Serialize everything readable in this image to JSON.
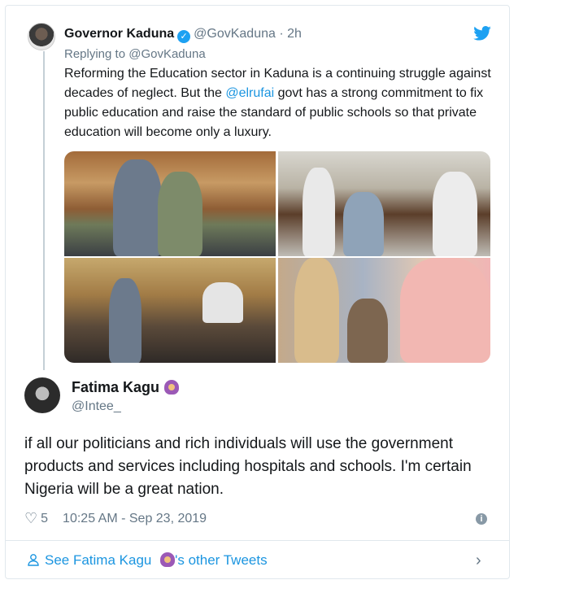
{
  "quoted_tweet": {
    "name": "Governor Kaduna",
    "handle": "@GovKaduna",
    "time": "2h",
    "replying_to": "Replying to @GovKaduna",
    "text_before": "Reforming the Education sector in Kaduna is a continuing struggle against decades of neglect. But the ",
    "mention": "@elrufai",
    "text_after": " govt has a strong commitment to fix public education and raise the standard of public schools so that private education will become only a luxury.",
    "photo_count": 4
  },
  "tweet": {
    "name": "Fatima Kagu",
    "handle": "@Intee_",
    "text": "if all our politicians and rich individuals will use the government products and services including hospitals and schools. I'm certain Nigeria will be a great nation.",
    "likes": "5",
    "timestamp": "10:25 AM - Sep 23, 2019"
  },
  "footer": {
    "prefix": "See Fatima Kagu",
    "suffix": "'s other Tweets"
  },
  "icons": {
    "verified": "verified-badge-icon",
    "bird": "twitter-bird-icon",
    "heart": "heart-icon",
    "info": "info-icon",
    "person": "person-icon",
    "chevron": "chevron-right-icon"
  },
  "colors": {
    "accent": "#1da1f2",
    "link": "#1b95e0",
    "muted": "#657786"
  }
}
